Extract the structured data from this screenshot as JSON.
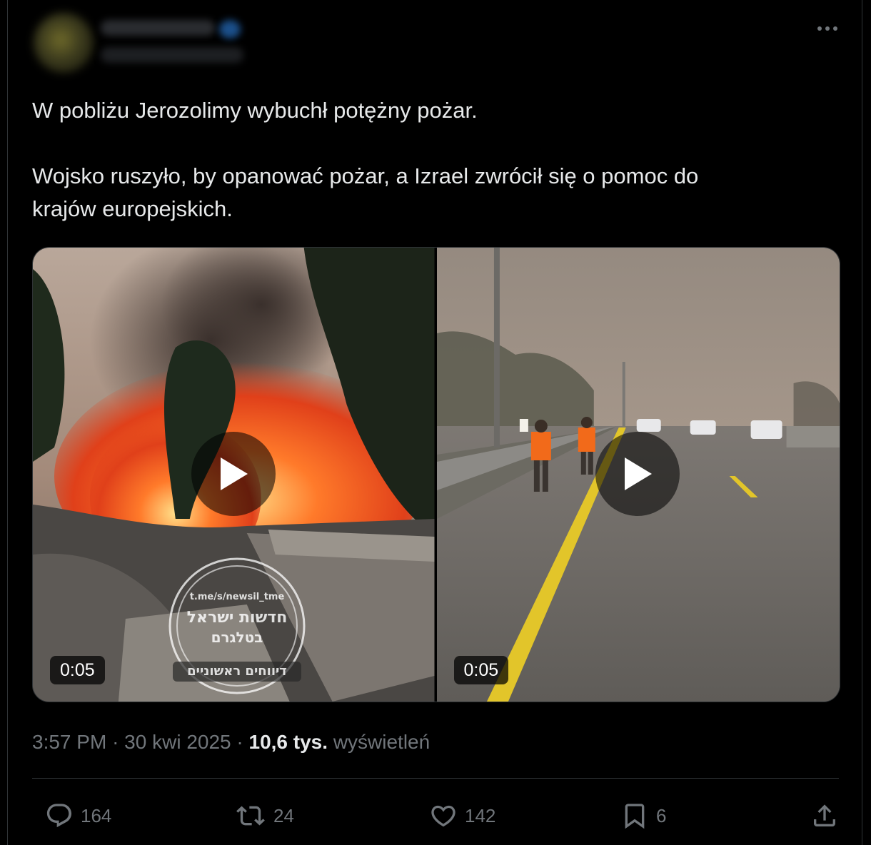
{
  "tweet": {
    "text_line1": "W pobliżu Jerozolimy wybuchł potężny pożar.",
    "text_line2": "Wojsko ruszyło, by opanować pożar, a Izrael zwrócił się o pomoc do",
    "text_line3": "krajów europejskich.",
    "more_icon": "more-horizontal-icon"
  },
  "media": {
    "video_left": {
      "duration": "0:05",
      "watermark_url": "t.me/s/newsil_tme",
      "watermark_line1": "חדשות ישראל",
      "watermark_line2": "בטלגרם",
      "watermark_line3": "דיווחים ראשוניים"
    },
    "video_right": {
      "duration": "0:05"
    }
  },
  "meta": {
    "time": "3:57 PM",
    "separator": "·",
    "date": "30 kwi 2025",
    "views_count": "10,6 tys.",
    "views_label": "wyświetleń"
  },
  "actions": {
    "replies": "164",
    "reposts": "24",
    "likes": "142",
    "bookmarks": "6"
  },
  "colors": {
    "background": "#000000",
    "text": "#e7e9ea",
    "secondary_text": "#71767b",
    "border": "#2f3336"
  }
}
